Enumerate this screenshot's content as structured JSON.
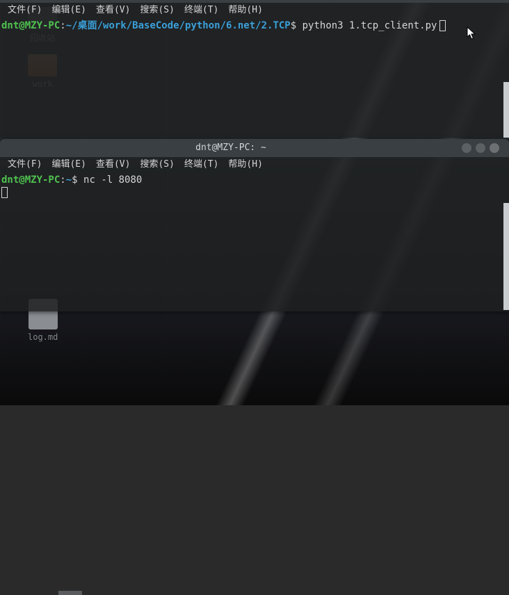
{
  "desktop": {
    "trash_label": "回收站",
    "folder_label": "work",
    "logmd_label": "log.md"
  },
  "menu": {
    "file": "文件(F)",
    "edit": "编辑(E)",
    "view": "查看(V)",
    "search": "搜索(S)",
    "term": "终端(T)",
    "help": "帮助(H)"
  },
  "term1": {
    "prompt_user": "dnt@MZY-PC",
    "prompt_colon": ":",
    "prompt_path": "~/桌面/work/BaseCode/python/6.net/2.TCP",
    "prompt_dollar": "$ ",
    "command": "python3 1.tcp_client.py"
  },
  "term2": {
    "title": "dnt@MZY-PC: ~",
    "prompt_user": "dnt@MZY-PC",
    "prompt_colon": ":",
    "prompt_path": "~",
    "prompt_dollar": "$ ",
    "command": "nc -l 8080"
  }
}
